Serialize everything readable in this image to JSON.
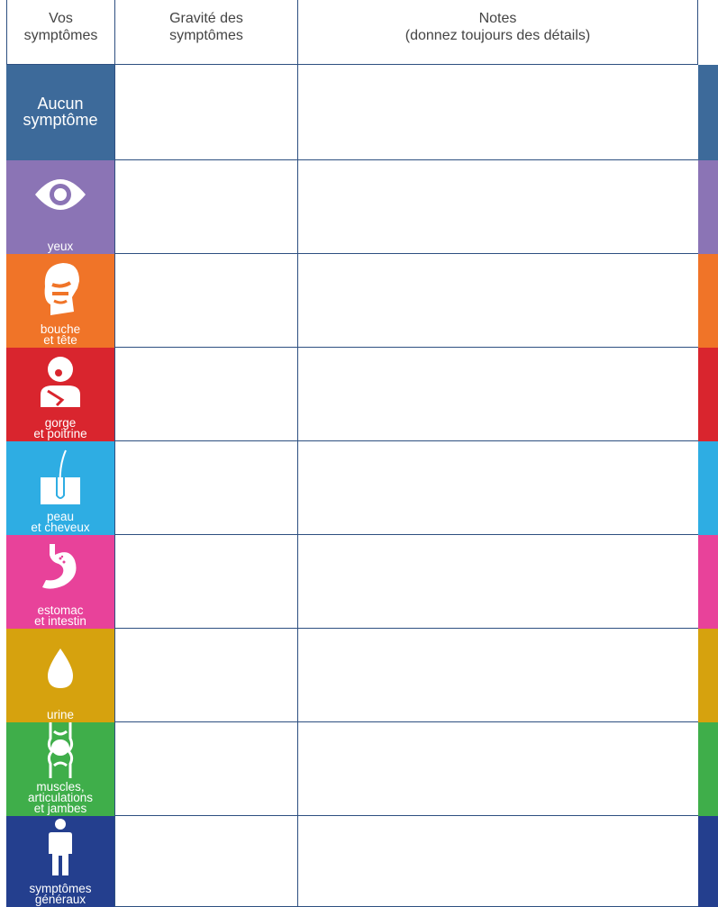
{
  "header": {
    "col1_line1": "Vos",
    "col1_line2": "symptômes",
    "col2_line1": "Gravité des",
    "col2_line2": "symptômes",
    "col3_line1": "Notes",
    "col3_line2": "(donnez toujours des détails)"
  },
  "rows": [
    {
      "label_lines": [
        "Aucun",
        "symptôme"
      ],
      "icon": "none",
      "color": "#3d6a9a"
    },
    {
      "label_lines": [
        "yeux"
      ],
      "icon": "eye-icon",
      "color": "#8b74b5"
    },
    {
      "label_lines": [
        "bouche",
        "et tête"
      ],
      "icon": "head-mouth-icon",
      "color": "#f07428"
    },
    {
      "label_lines": [
        "gorge",
        "et poitrine"
      ],
      "icon": "throat-chest-icon",
      "color": "#d9252e"
    },
    {
      "label_lines": [
        "peau",
        "et cheveux"
      ],
      "icon": "skin-hair-icon",
      "color": "#2eade3"
    },
    {
      "label_lines": [
        "estomac",
        "et intestin"
      ],
      "icon": "stomach-icon",
      "color": "#e8429a"
    },
    {
      "label_lines": [
        "urine"
      ],
      "icon": "drop-icon",
      "color": "#d6a20e"
    },
    {
      "label_lines": [
        "muscles,",
        "articulations",
        "et jambes"
      ],
      "icon": "joint-icon",
      "color": "#3fae4a"
    },
    {
      "label_lines": [
        "symptômes",
        "généraux"
      ],
      "icon": "person-icon",
      "color": "#243f8e"
    }
  ]
}
